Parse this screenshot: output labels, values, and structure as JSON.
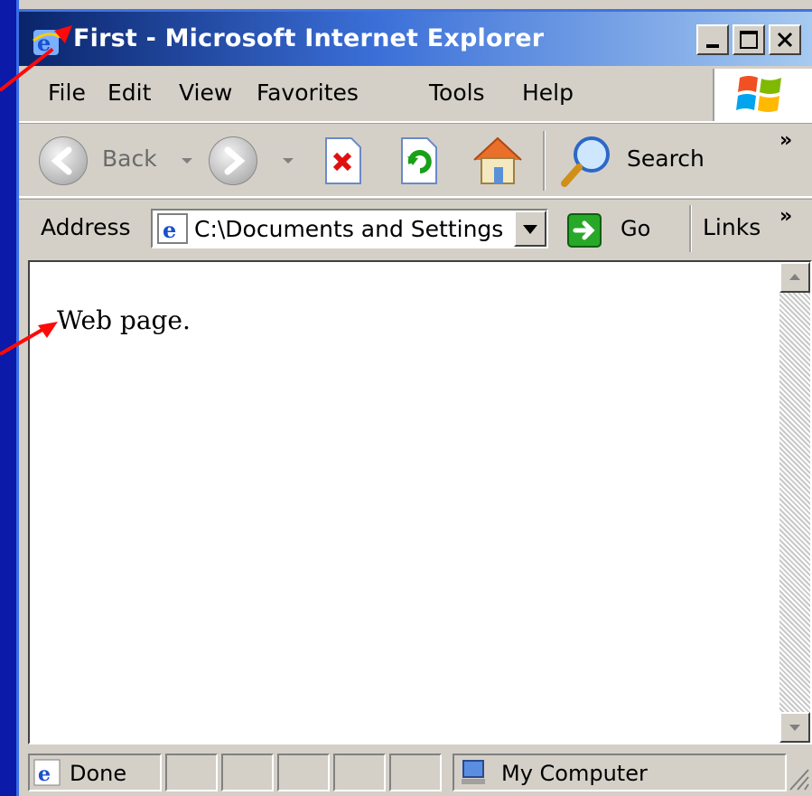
{
  "window": {
    "title": "First - Microsoft Internet Explorer",
    "controls": [
      "minimize",
      "maximize",
      "close"
    ]
  },
  "menu": {
    "items": [
      "File",
      "Edit",
      "View",
      "Favorites",
      "Tools",
      "Help"
    ]
  },
  "toolbar": {
    "back_label": "Back",
    "search_label": "Search",
    "more_glyph": "»"
  },
  "address": {
    "label": "Address",
    "value": "C:\\Documents and Settings",
    "go_label": "Go",
    "links_label": "Links",
    "more_glyph": "»"
  },
  "page": {
    "text": "Web page."
  },
  "status": {
    "text": "Done",
    "zone": "My Computer"
  },
  "colors": {
    "background": "#0b1aa8",
    "annotation_arrow": "#ff0a0a",
    "titlebar_start": "#0a246a",
    "titlebar_end": "#a6caf0"
  }
}
